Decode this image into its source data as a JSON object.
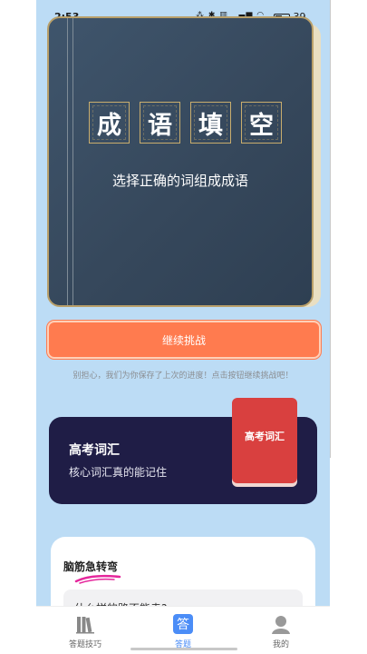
{
  "status_bar": {
    "time": "2:53",
    "indicators": "⁂ ✱ ▥ ▂▄▆ ◠",
    "battery": "39"
  },
  "book_card": {
    "title_chars": [
      "成",
      "语",
      "填",
      "空"
    ],
    "subtitle": "选择正确的词组成成语"
  },
  "continue": {
    "label": "继续挑战",
    "hint": "别担心，我们为你保存了上次的进度！点击按钮继续挑战吧！"
  },
  "vocab_card": {
    "title": "高考词汇",
    "subtitle": "核心词汇真的能记住",
    "badge": "高考词汇"
  },
  "teaser_card": {
    "title": "脑筋急转弯",
    "question": "什么样的路不能走?"
  },
  "bottom_nav": {
    "items": [
      {
        "label": "答题技巧",
        "icon": "books-icon"
      },
      {
        "label": "答题",
        "icon": "answer-icon",
        "glyph": "答"
      },
      {
        "label": "我的",
        "icon": "profile-icon"
      }
    ]
  },
  "colors": {
    "background": "#bcdcf5",
    "book": "#3f556c",
    "accent_orange": "#ff7b4f",
    "vocab_card": "#1f1d46",
    "red_book": "#d9403f",
    "nav_active": "#4b8df7"
  }
}
